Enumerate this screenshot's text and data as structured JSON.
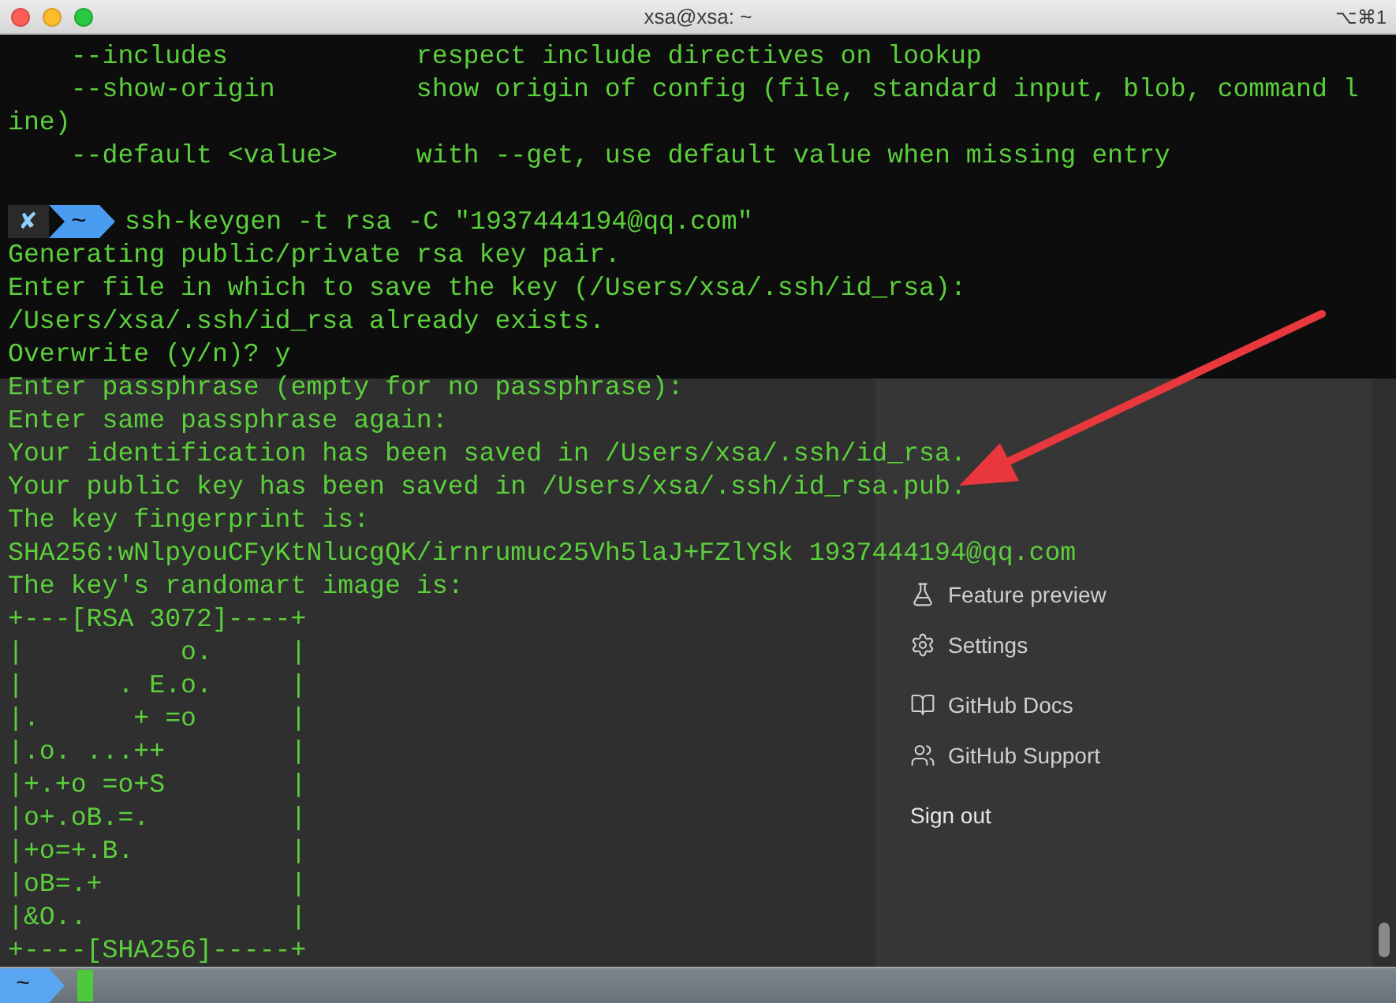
{
  "window": {
    "title": "xsa@xsa: ~",
    "shortcut": "⌥⌘1"
  },
  "terminal": {
    "lines": [
      {
        "kind": "output",
        "text": "    --includes            respect include directives on lookup"
      },
      {
        "kind": "output",
        "text": "    --show-origin         show origin of config (file, standard input, blob, command l"
      },
      {
        "kind": "output",
        "text": "ine)"
      },
      {
        "kind": "output",
        "text": "    --default <value>     with --get, use default value when missing entry"
      },
      {
        "kind": "blank"
      },
      {
        "kind": "prompt",
        "status": "✘",
        "path": "~",
        "command": "ssh-keygen -t rsa -C \"1937444194@qq.com\""
      },
      {
        "kind": "output",
        "text": "Generating public/private rsa key pair."
      },
      {
        "kind": "output",
        "text": "Enter file in which to save the key (/Users/xsa/.ssh/id_rsa):"
      },
      {
        "kind": "output",
        "text": "/Users/xsa/.ssh/id_rsa already exists."
      },
      {
        "kind": "output",
        "text": "Overwrite (y/n)? y"
      },
      {
        "kind": "output",
        "text": "Enter passphrase (empty for no passphrase):"
      },
      {
        "kind": "output",
        "text": "Enter same passphrase again:"
      },
      {
        "kind": "output",
        "text": "Your identification has been saved in /Users/xsa/.ssh/id_rsa."
      },
      {
        "kind": "output",
        "text": "Your public key has been saved in /Users/xsa/.ssh/id_rsa.pub."
      },
      {
        "kind": "output",
        "text": "The key fingerprint is:"
      },
      {
        "kind": "output",
        "text": "SHA256:wNlpyouCFyKtNlucgQK/irnrumuc25Vh5laJ+FZlYSk 1937444194@qq.com"
      },
      {
        "kind": "output",
        "text": "The key's randomart image is:"
      },
      {
        "kind": "output",
        "text": "+---[RSA 3072]----+"
      },
      {
        "kind": "output",
        "text": "|          o.     |"
      },
      {
        "kind": "output",
        "text": "|      . E.o.     |"
      },
      {
        "kind": "output",
        "text": "|.      + =o      |"
      },
      {
        "kind": "output",
        "text": "|.o. ...++        |"
      },
      {
        "kind": "output",
        "text": "|+.+o =o+S        |"
      },
      {
        "kind": "output",
        "text": "|o+.oB.=.         |"
      },
      {
        "kind": "output",
        "text": "|+o=+.B.          |"
      },
      {
        "kind": "output",
        "text": "|oB=.+            |"
      },
      {
        "kind": "output",
        "text": "|&O..             |"
      },
      {
        "kind": "output",
        "text": "+----[SHA256]-----+"
      }
    ]
  },
  "background_menu": {
    "groups": [
      [
        {
          "kind": "feature",
          "label": "Feature preview"
        },
        {
          "kind": "settings",
          "label": "Settings"
        }
      ],
      [
        {
          "kind": "docs",
          "label": "GitHub Docs"
        },
        {
          "kind": "support",
          "label": "GitHub Support"
        }
      ],
      [
        {
          "kind": "signout",
          "label": "Sign out"
        }
      ]
    ]
  },
  "status_bar": {
    "path": "~"
  }
}
